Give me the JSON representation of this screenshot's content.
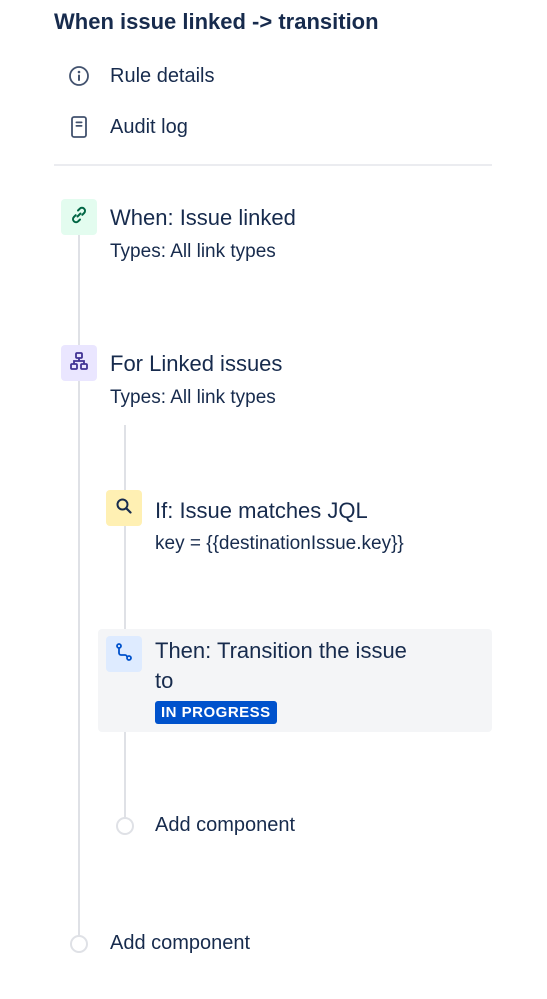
{
  "rule": {
    "title": "When issue linked -> transition"
  },
  "nav": {
    "rule_details": "Rule details",
    "audit_log": "Audit log"
  },
  "components": {
    "trigger": {
      "title": "When: Issue linked",
      "subtitle": "Types: All link types",
      "icon": "link-icon",
      "icon_bg": "#e3fcef",
      "icon_color": "#006644"
    },
    "branch": {
      "title": "For Linked issues",
      "subtitle": "Types: All link types",
      "icon": "hierarchy-icon",
      "icon_bg": "#eae6ff",
      "icon_color": "#403294"
    },
    "condition": {
      "title": "If: Issue matches JQL",
      "subtitle": "key = {{destinationIssue.key}}",
      "icon": "search-icon",
      "icon_bg": "#fff0b3",
      "icon_color": "#172b4d"
    },
    "action": {
      "title_line1": "Then: Transition the issue",
      "title_line2": "to",
      "status": "IN PROGRESS",
      "status_color": "#0052cc",
      "icon": "transition-icon",
      "icon_bg": "#deebff",
      "icon_color": "#0052cc"
    }
  },
  "add_component": {
    "branch_label": "Add component",
    "rule_label": "Add component"
  }
}
